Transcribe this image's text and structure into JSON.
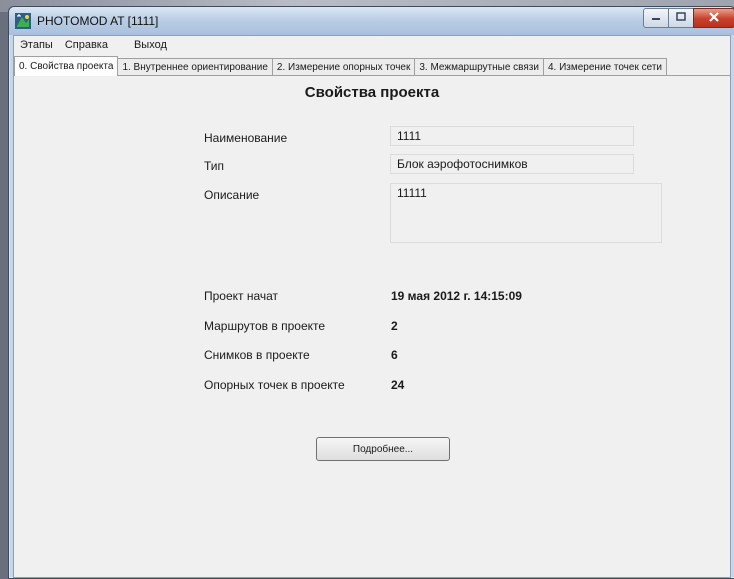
{
  "window": {
    "title": "PHOTOMOD AT [1111]",
    "controls": {
      "minimize_icon": "minimize-icon",
      "maximize_icon": "maximize-icon",
      "close_icon": "close-icon"
    }
  },
  "menu": [
    "Этапы",
    "Справка",
    "Выход"
  ],
  "tabs": [
    "0. Свойства проекта",
    "1. Внутреннее ориентирование",
    "2. Измерение опорных точек",
    "3. Межмаршрутные связи",
    "4. Измерение точек сети"
  ],
  "page": {
    "title": "Свойства проекта",
    "fields": {
      "name_label": "Наименование",
      "name_value": "1111",
      "type_label": "Тип",
      "type_value": "Блок аэрофотоснимков",
      "description_label": "Описание",
      "description_value": "11111"
    },
    "stats": {
      "started_label": "Проект начат",
      "started_value": "19 мая 2012 г. 14:15:09",
      "routes_label": "Маршрутов в проекте",
      "routes_value": "2",
      "images_label": "Снимков в проекте",
      "images_value": "6",
      "gcp_label": "Опорных точек в проекте",
      "gcp_value": "24"
    },
    "details_button": "Подробнее..."
  },
  "colors": {
    "accent_close": "#c7402a",
    "titlebar": "#b8cce4",
    "panel": "#f0f0f0"
  }
}
